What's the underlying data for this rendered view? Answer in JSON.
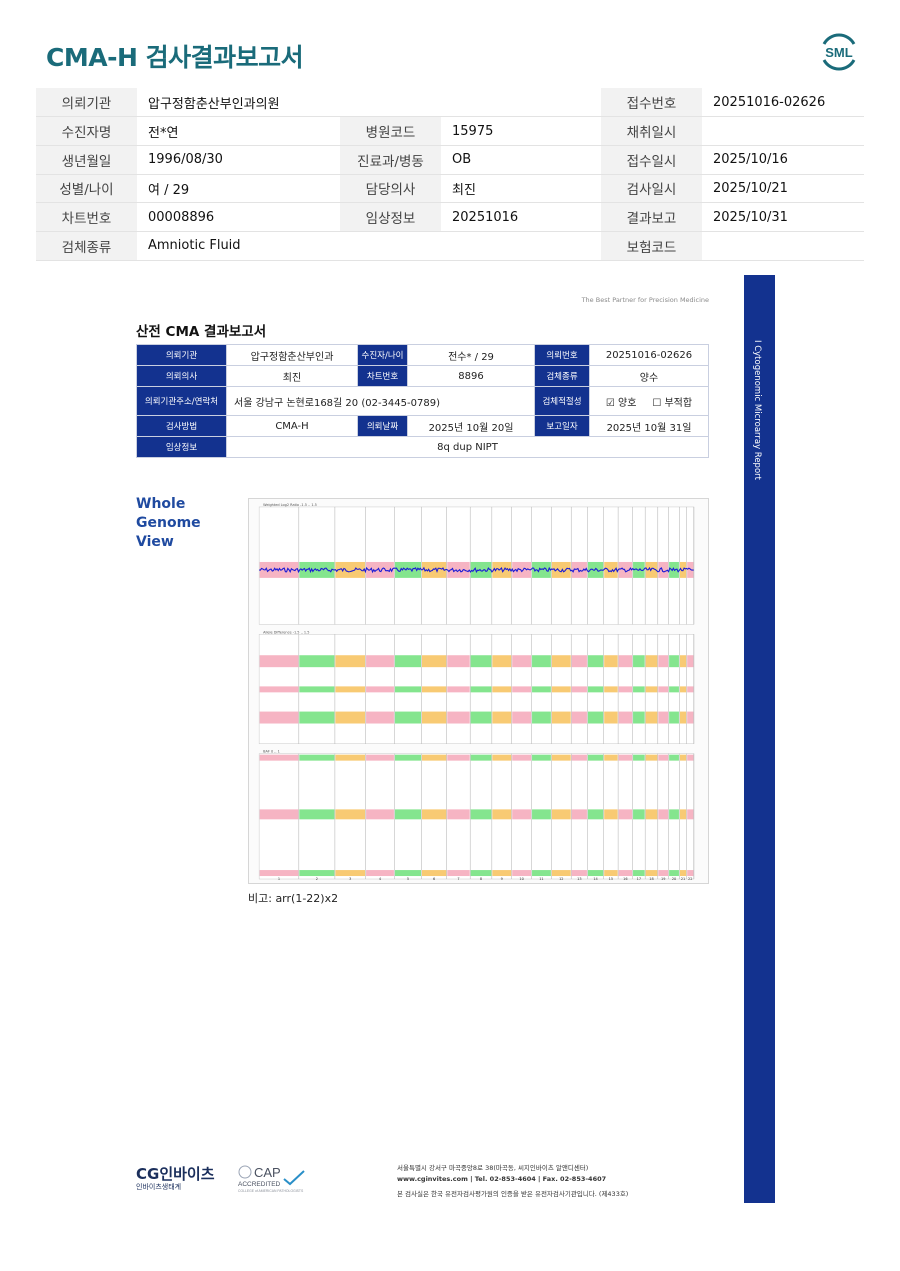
{
  "report_title": "CMA-H 검사결과보고서",
  "logo_text": "SML",
  "header": {
    "rows": [
      [
        {
          "label": "의뢰기관",
          "value": "압구정함춘산부인과의원"
        },
        null,
        {
          "label": "접수번호",
          "value": "20251016-02626"
        }
      ],
      [
        {
          "label": "수진자명",
          "value": "전*연"
        },
        {
          "label": "병원코드",
          "value": "15975"
        },
        {
          "label": "채취일시",
          "value": ""
        }
      ],
      [
        {
          "label": "생년월일",
          "value": "1996/08/30"
        },
        {
          "label": "진료과/병동",
          "value": "OB"
        },
        {
          "label": "접수일시",
          "value": "2025/10/16"
        }
      ],
      [
        {
          "label": "성별/나이",
          "value": "여 / 29"
        },
        {
          "label": "담당의사",
          "value": "최진"
        },
        {
          "label": "검사일시",
          "value": "2025/10/21"
        }
      ],
      [
        {
          "label": "차트번호",
          "value": "00008896"
        },
        {
          "label": "임상정보",
          "value": "20251016"
        },
        {
          "label": "결과보고",
          "value": "2025/10/31"
        }
      ],
      [
        {
          "label": "검체종류",
          "value": "Amniotic Fluid"
        },
        null,
        {
          "label": "보험코드",
          "value": ""
        }
      ]
    ]
  },
  "report": {
    "tagline": "The Best Partner for Precision Medicine",
    "side_label": "I   Cytogenomic Microarray Report",
    "subtitle": "산전 CMA 결과보고서",
    "info": {
      "h_institution": "의뢰기관",
      "institution": "압구정함춘산부인과",
      "h_patient": "수진자/나이",
      "patient": "전수* / 29",
      "h_request_no": "의뢰번호",
      "request_no": "20251016-02626",
      "h_doctor": "의뢰의사",
      "doctor": "최진",
      "h_chart": "차트번호",
      "chart": "8896",
      "h_specimen": "검체종류",
      "specimen": "양수",
      "h_address": "의뢰기관주소/연락처",
      "address": "서울 강남구 논현로168길 20 (02-3445-0789)",
      "h_suitability": "검체적절성",
      "suit_ok": "☑ 양호",
      "suit_bad": "☐ 부적합",
      "h_method": "검사방법",
      "method": "CMA-H",
      "h_request_date": "의뢰날짜",
      "request_date": "2025년 10월 20일",
      "h_report_date": "보고일자",
      "report_date": "2025년 10월 31일",
      "h_clinical": "임상정보",
      "clinical": "8q dup NIPT"
    },
    "wgv_title": [
      "Whole",
      "Genome",
      "View"
    ],
    "plot": {
      "panel_titles": [
        "Weighted Log2 Ratio -1.5 .. 1.5",
        "Allele Difference -1.5 .. 1.5",
        "BAF 0 .. 1"
      ],
      "chromosomes": [
        "1",
        "2",
        "3",
        "4",
        "5",
        "6",
        "7",
        "8",
        "9",
        "10",
        "11",
        "12",
        "13",
        "14",
        "15",
        "16",
        "17",
        "18",
        "19",
        "20",
        "21",
        "22"
      ],
      "colors": {
        "pink": "#f4a7b9",
        "green": "#6ee07a",
        "orange": "#f7c15a",
        "blue": "#1a1ad6"
      }
    },
    "note": "비고: arr(1-22)x2",
    "footer": {
      "brand": "CG인바이츠",
      "brand_sub": "인바이츠생태계",
      "cap": "CAP",
      "cap_sub": "ACCREDITED",
      "cap_small": "COLLEGE of AMERICAN PATHOLOGISTS",
      "address": "서울특별시 강서구 마곡중앙8로 38(마곡동, 씨지인바이츠 알앤디센터)",
      "contact": "www.cginvites.com  |  Tel. 02-853-4604  |  Fax. 02-853-4607",
      "cert": "본 검사실은 한국 유전자검사평가원의 인증을 받은 유전자검사기관입니다. (제433호)"
    }
  }
}
